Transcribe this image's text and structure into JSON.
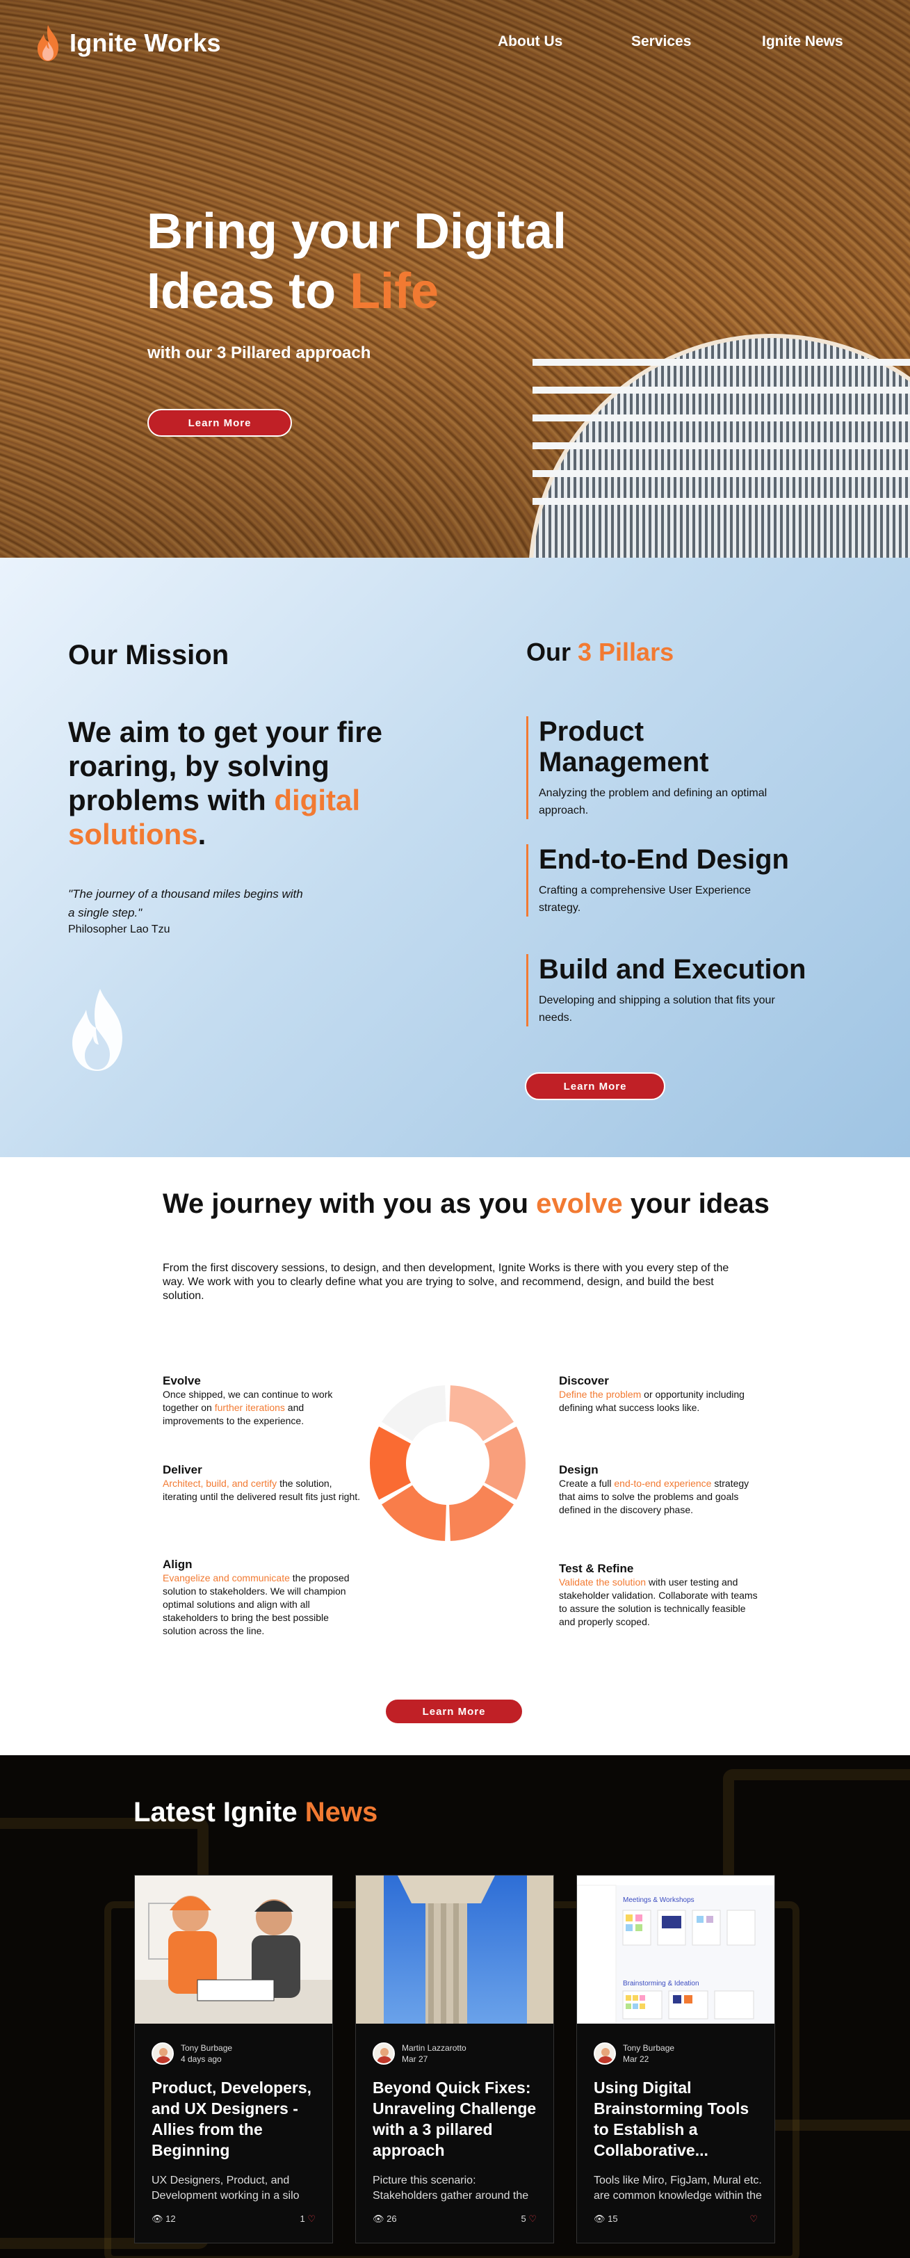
{
  "brand": {
    "name": "Ignite Works",
    "accent": "#f27a32",
    "button_red": "#c02026"
  },
  "nav": {
    "items": [
      "About Us",
      "Services",
      "Ignite News"
    ]
  },
  "hero": {
    "title_line1": "Bring your Digital",
    "title_line2_start": "Ideas to ",
    "title_line2_accent": "Life",
    "subtitle": "with our 3 Pillared approach",
    "button": "Learn More"
  },
  "mission": {
    "heading": "Our Mission",
    "statement_start": "We aim to get your fire roaring, by solving problems with ",
    "statement_accent": "digital solutions",
    "statement_end": ".",
    "quote": "\"The journey of a thousand miles begins with a single step.\"",
    "quote_author": "Philosopher Lao Tzu"
  },
  "pillars": {
    "heading_start": "Our ",
    "heading_accent": "3 Pillars",
    "items": [
      {
        "title": "Product Management",
        "text": "Analyzing the problem and defining an optimal approach."
      },
      {
        "title": "End-to-End Design",
        "text": "Crafting a comprehensive User Experience strategy."
      },
      {
        "title": "Build and Execution",
        "text": "Developing and shipping a solution that fits your needs."
      }
    ],
    "button": "Learn More"
  },
  "journey": {
    "heading_start": "We journey with you as you ",
    "heading_accent": "evolve",
    "heading_end": " your ideas",
    "intro": "From the first discovery sessions, to design, and then development, Ignite Works is there with you every step of the way. We work with you to clearly define what you are trying to solve, and recommend, design, and build the best solution.",
    "stages": {
      "evolve": {
        "title": "Evolve",
        "pre": "Once shipped, we can continue to work together on ",
        "hl": "further iterations",
        "post": " and improvements to the experience."
      },
      "deliver": {
        "title": "Deliver",
        "pre": "",
        "hl": "Architect, build, and certify",
        "post": " the solution, iterating until the delivered result fits just right."
      },
      "align": {
        "title": "Align",
        "pre": "",
        "hl": "Evangelize and communicate",
        "post": " the proposed solution to stakeholders. We will champion optimal solutions and align with all stakeholders to bring the best possible solution across the line."
      },
      "discover": {
        "title": "Discover",
        "pre": "",
        "hl": "Define the problem",
        "post": " or opportunity including defining what success looks like."
      },
      "design": {
        "title": "Design",
        "pre": "Create a full ",
        "hl": "end-to-end experience",
        "post": " strategy that aims to solve the problems and goals defined in the discovery phase."
      },
      "test": {
        "title": "Test & Refine",
        "pre": "",
        "hl": "Validate the solution",
        "post": " with user testing and stakeholder validation. Collaborate with teams to assure the solution is technically feasible and properly scoped."
      }
    },
    "button": "Learn More",
    "ring_colors": [
      "#fbb79c",
      "#f99f7c",
      "#f88455",
      "#f97d4a",
      "#fa6b32",
      "#f4f4f4"
    ]
  },
  "news": {
    "heading_start": "Latest Ignite ",
    "heading_accent": "News",
    "cards": [
      {
        "author": "Tony Burbage",
        "date": "4 days ago",
        "title": "Product, Developers, and UX Designers - Allies from the Beginning",
        "excerpt": "UX Designers, Product, and Development working in a silo",
        "views": "12",
        "likes": "1"
      },
      {
        "author": "Martin Lazzarotto",
        "date": "Mar 27",
        "title": "Beyond Quick Fixes: Unraveling Challenge with a 3 pillared approach",
        "excerpt": "Picture this scenario: Stakeholders gather around the",
        "views": "26",
        "likes": "5"
      },
      {
        "author": "Tony Burbage",
        "date": "Mar 22",
        "title": "Using Digital Brainstorming Tools to Establish a Collaborative...",
        "excerpt": "Tools like Miro, FigJam, Mural etc. are common knowledge within the",
        "views": "15",
        "likes": ""
      }
    ],
    "board_labels": {
      "meetings": "Meetings & Workshops",
      "brainstorm": "Brainstorming & Ideation"
    }
  }
}
